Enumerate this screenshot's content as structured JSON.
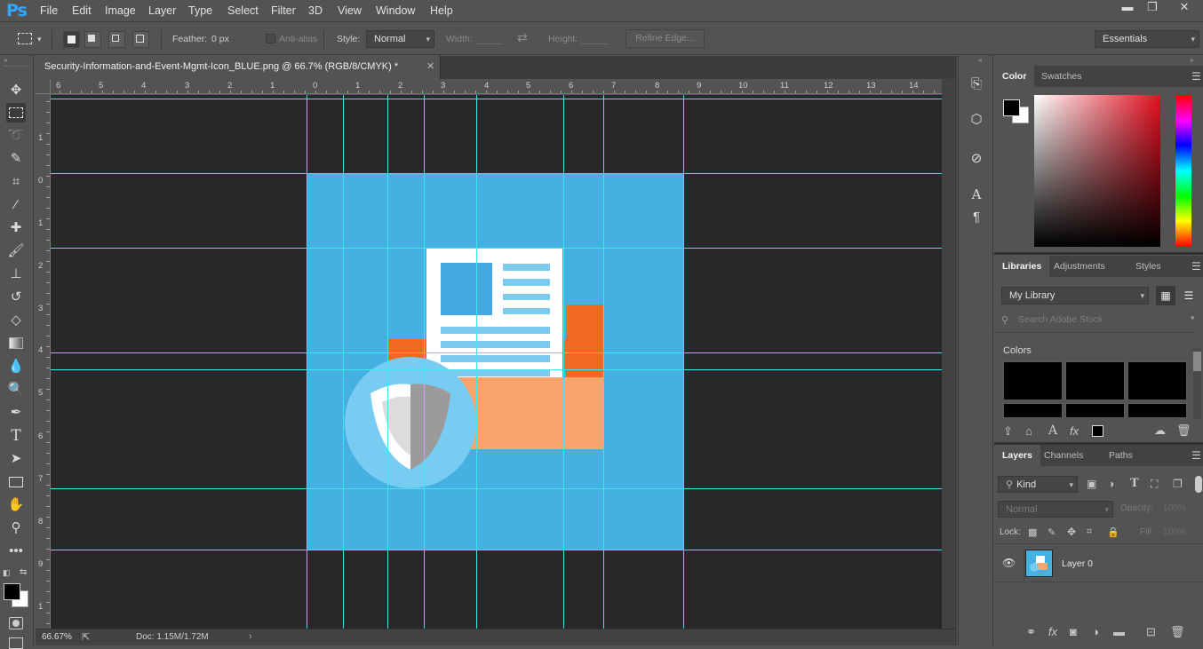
{
  "app": {
    "logo": "Ps"
  },
  "menu": [
    "File",
    "Edit",
    "Image",
    "Layer",
    "Type",
    "Select",
    "Filter",
    "3D",
    "View",
    "Window",
    "Help"
  ],
  "window_controls": {
    "minimize": "▬",
    "restore": "❐",
    "close": "✕"
  },
  "options": {
    "feather_label": "Feather:",
    "feather_value": "0 px",
    "antialias_label": "Anti-alias",
    "style_label": "Style:",
    "style_value": "Normal",
    "width_label": "Width:",
    "height_label": "Height:",
    "refine_edge": "Refine Edge...",
    "workspace": "Essentials"
  },
  "document": {
    "tab_title": "Security-Information-and-Event-Mgmt-Icon_BLUE.png @ 66.7% (RGB/8/CMYK) *",
    "close": "✕",
    "zoom": "66.67%",
    "doc_size": "Doc: 1.15M/1.72M"
  },
  "rulers": {
    "top": [
      "6",
      "5",
      "4",
      "3",
      "2",
      "1",
      "0",
      "1",
      "2",
      "3",
      "4",
      "5",
      "6",
      "7",
      "8",
      "9",
      "10",
      "11",
      "12",
      "13",
      "14"
    ],
    "left": [
      "1",
      "0",
      "1",
      "2",
      "3",
      "4",
      "5",
      "6",
      "7",
      "8",
      "9",
      "1"
    ]
  },
  "artwork_colors": {
    "background": "#45b0e2",
    "document": "#ffffff",
    "accent_blue": "#45a9df",
    "line_blue": "#7ecaef",
    "folder_dark": "#f26a22",
    "folder_light": "#f9a36d",
    "circle": "#78cbf1",
    "shield_grey": "#9b9b9b",
    "shield_light": "#dcdcdc",
    "guide": "#3ee7ef"
  },
  "tools": [
    "move-icon",
    "marquee-icon",
    "lasso-icon",
    "quick-select-icon",
    "crop-icon",
    "eyedropper-icon",
    "healing-icon",
    "brush-icon",
    "stamp-icon",
    "history-brush-icon",
    "eraser-icon",
    "gradient-icon",
    "blur-icon",
    "dodge-icon",
    "pen-icon",
    "type-icon",
    "path-select-icon",
    "rectangle-icon",
    "hand-icon",
    "zoom-icon",
    "more-tools-icon"
  ],
  "type_tool_glyph": "T",
  "color_panel": {
    "tabs": [
      "Color",
      "Swatches"
    ]
  },
  "libraries_panel": {
    "tabs": [
      "Libraries",
      "Adjustments",
      "Styles"
    ],
    "library": "My Library",
    "search_placeholder": "Search Adobe Stock",
    "colors_heading": "Colors"
  },
  "layers_panel": {
    "tabs": [
      "Layers",
      "Channels",
      "Paths"
    ],
    "filter": "Kind",
    "blend_mode": "Normal",
    "opacity_label": "Opacity:",
    "opacity_value": "100%",
    "lock_label": "Lock:",
    "fill_label": "Fill:",
    "fill_value": "100%",
    "layers": [
      {
        "name": "Layer 0",
        "visible": true
      }
    ]
  },
  "layer_icon_glyphs": {
    "text": "T",
    "fx": "fx"
  },
  "library_icon_glyphs": {
    "text": "A",
    "fx": "fx"
  },
  "strip_glyphs": {
    "character": "A",
    "paragraph": "¶"
  }
}
